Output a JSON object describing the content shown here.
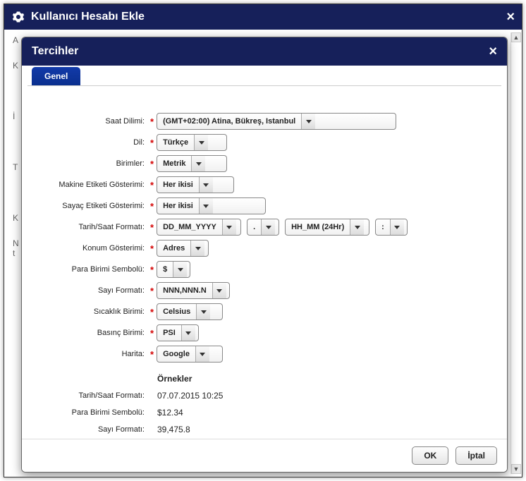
{
  "outer": {
    "title": "Kullanıcı Hesabı Ekle"
  },
  "inner": {
    "title": "Tercihler",
    "tab_general": "Genel",
    "labels": {
      "timezone": "Saat Dilimi:",
      "language": "Dil:",
      "units": "Birimler:",
      "machine_label": "Makine Etiketi Gösterimi:",
      "meter_label": "Sayaç Etiketi Gösterimi:",
      "datetime": "Tarih/Saat Formatı:",
      "location": "Konum Gösterimi:",
      "currency": "Para Birimi Sembolü:",
      "number": "Sayı Formatı:",
      "temperature": "Sıcaklık Birimi:",
      "pressure": "Basınç Birimi:",
      "map": "Harita:"
    },
    "values": {
      "timezone": "(GMT+02:00) Atina, Bükreş, Istanbul",
      "language": "Türkçe",
      "units": "Metrik",
      "machine_label": "Her ikisi",
      "meter_label": "Her ikisi",
      "date_format": "DD_MM_YYYY",
      "date_sep": ".",
      "time_format": "HH_MM (24Hr)",
      "time_sep": ":",
      "location": "Adres",
      "currency": "$",
      "number": "NNN,NNN.N",
      "temperature": "Celsius",
      "pressure": "PSI",
      "map": "Google"
    },
    "examples": {
      "heading": "Örnekler",
      "datetime_label": "Tarih/Saat Formatı:",
      "datetime_value": "07.07.2015 10:25",
      "currency_label": "Para Birimi Sembolü:",
      "currency_value": "$12.34",
      "number_label": "Sayı Formatı:",
      "number_value": "39,475.8"
    },
    "buttons": {
      "ok": "OK",
      "cancel": "İptal"
    }
  }
}
